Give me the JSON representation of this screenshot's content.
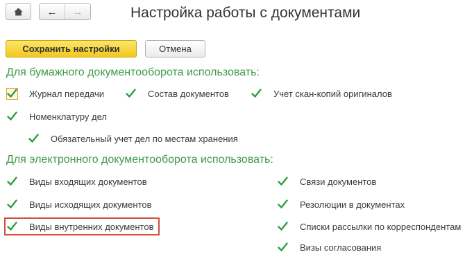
{
  "header": {
    "title": "Настройка работы с документами"
  },
  "toolbar": {
    "save_label": "Сохранить настройки",
    "cancel_label": "Отмена"
  },
  "paper": {
    "heading": "Для бумажного документооборота использовать:",
    "items": [
      {
        "label": "Журнал передачи",
        "checked": true
      },
      {
        "label": "Состав документов",
        "checked": true
      },
      {
        "label": "Учет скан-копий оригиналов",
        "checked": true
      },
      {
        "label": "Номенклатуру дел",
        "checked": true
      },
      {
        "label": "Обязательный учет дел по местам хранения",
        "checked": true
      }
    ]
  },
  "electronic": {
    "heading": "Для электронного документооборота использовать:",
    "items": [
      {
        "label": "Виды входящих документов",
        "checked": true
      },
      {
        "label": "Виды исходящих документов",
        "checked": true
      },
      {
        "label": "Виды внутренних документов",
        "checked": true
      },
      {
        "label": "Связи документов",
        "checked": true
      },
      {
        "label": "Резолюции в документах",
        "checked": true
      },
      {
        "label": "Списки рассылки по корреспондентам",
        "checked": true
      },
      {
        "label": "Визы согласования",
        "checked": true
      }
    ]
  },
  "colors": {
    "accent_green": "#3e9a48",
    "check_green": "#2e9e3e",
    "save_button_yellow": "#f6d43a",
    "highlight_red": "#d64b3e"
  },
  "icons": {
    "home": "home-icon",
    "back": "arrow-left-icon",
    "forward": "arrow-right-icon",
    "check": "checkmark-icon"
  }
}
